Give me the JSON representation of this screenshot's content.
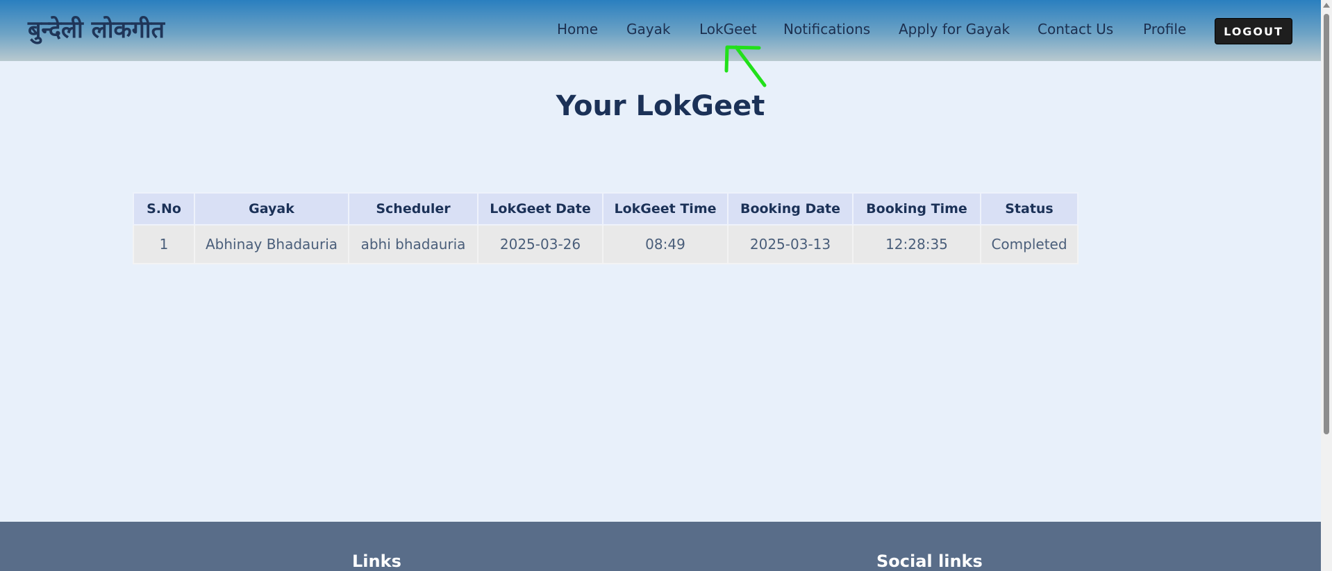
{
  "header": {
    "brand": "बुन्देली लोकगीत",
    "nav": [
      "Home",
      "Gayak",
      "LokGeet",
      "Notifications",
      "Apply for Gayak",
      "Contact Us",
      "Profile"
    ],
    "logout_label": "LOGOUT",
    "annotation_color": "#22e01a"
  },
  "main": {
    "title": "Your LokGeet",
    "table": {
      "headers": [
        "S.No",
        "Gayak",
        "Scheduler",
        "LokGeet Date",
        "LokGeet Time",
        "Booking Date",
        "Booking Time",
        "Status"
      ],
      "rows": [
        [
          "1",
          "Abhinay Bhadauria",
          "abhi bhadauria",
          "2025-03-26",
          "08:49",
          "2025-03-13",
          "12:28:35",
          "Completed"
        ]
      ]
    }
  },
  "footer": {
    "links_heading": "Links",
    "social_heading": "Social links"
  }
}
